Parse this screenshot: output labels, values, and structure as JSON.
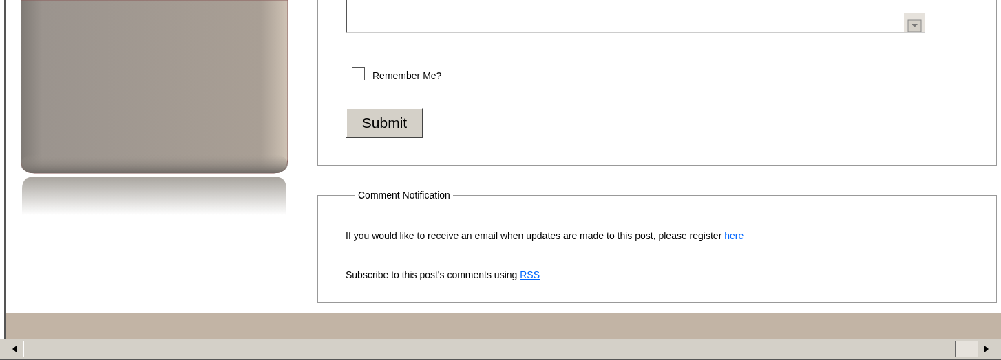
{
  "comment_form": {
    "remember_me": {
      "label": "Remember Me?",
      "checked": false
    },
    "submit": {
      "label": "Submit"
    }
  },
  "comment_notification": {
    "legend": "Comment Notification",
    "lines": [
      {
        "text": "If you would like to receive an email when updates are made to this post, please register ",
        "link": "here"
      },
      {
        "text": "Subscribe to this post's comments using ",
        "link": "RSS"
      }
    ]
  }
}
